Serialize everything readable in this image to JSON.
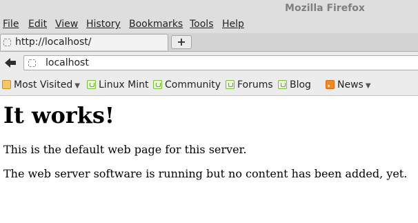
{
  "window": {
    "title": "Mozilla Firefox"
  },
  "menubar": {
    "items": [
      "File",
      "Edit",
      "View",
      "History",
      "Bookmarks",
      "Tools",
      "Help"
    ]
  },
  "tabs": [
    {
      "label": "http://localhost/",
      "favicon": "blank-page-icon",
      "active": true
    }
  ],
  "newtab": {
    "icon": "plus-icon",
    "label": "+"
  },
  "navbar": {
    "back_icon": "back-arrow-icon",
    "url": "localhost",
    "favicon": "blank-page-icon"
  },
  "bookmarks": [
    {
      "label": "Most Visited",
      "icon": "folder-icon",
      "dropdown": true
    },
    {
      "label": "Linux Mint",
      "icon": "mint-icon"
    },
    {
      "label": "Community",
      "icon": "mint-icon"
    },
    {
      "label": "Forums",
      "icon": "mint-icon"
    },
    {
      "label": "Blog",
      "icon": "mint-icon"
    },
    {
      "label": "News",
      "icon": "rss-icon",
      "dropdown": true
    }
  ],
  "page": {
    "heading": "It works!",
    "paragraphs": [
      "This is the default web page for this server.",
      "The web server software is running but no content has been added, yet."
    ]
  },
  "colors": {
    "chrome_bg": "#dedede",
    "toolbar_bg": "#ececec",
    "title_text": "#7f7f7f",
    "content_bg": "#ffffff"
  }
}
